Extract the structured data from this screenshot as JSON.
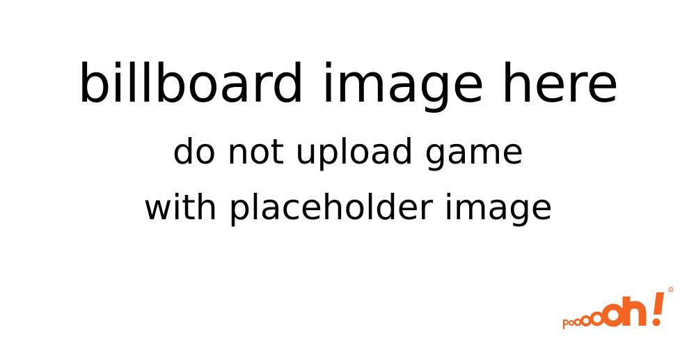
{
  "placeholder": {
    "headline": "billboard image here",
    "line1": "do not upload game",
    "line2": "with placeholder image"
  },
  "logo": {
    "icon": "poooh-logo",
    "brand_color": "#F26522",
    "text": "pOooOh!"
  }
}
